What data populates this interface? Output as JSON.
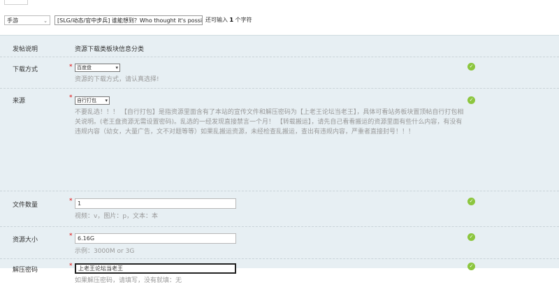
{
  "title_row": {
    "type_select": "手游",
    "title_value": "[SLG/动态/官中步兵] 谁能想到？Who thought it's possil",
    "remain_prefix": "还可输入",
    "remain_count": "1",
    "remain_suffix": "个字符"
  },
  "form": {
    "header_label": "发帖说明",
    "header_title": "资源下载类板块信息分类",
    "download_method": {
      "label": "下载方式",
      "select_value": "百度盘",
      "hint": "资源的下载方式，请认真选择!"
    },
    "source": {
      "label": "来源",
      "select_value": "自行打包",
      "description": "不要乱选！！！ 【自行打包】是指资源里面含有了本站的宣传文件和解压密码为【上老王论坛当老王】，具体可看站务板块置顶帖自行打包相关说明。(老王盘资源无需设置密码)。乱选的一经发现直接禁言一个月！ 【转载搬运】，请先自己看看搬运的资源里面有些什么内容，有没有违规内容（幼女，大量广告，文不对题等等）如果乱搬运资源，未经检查乱搬运，查出有违规内容，严重者直接封号！！！"
    },
    "file_count": {
      "label": "文件数量",
      "value": "1",
      "hint": "视频：v，图片：p，文本：本"
    },
    "resource_size": {
      "label": "资源大小",
      "value": "6.16G",
      "hint": "示例：3000M or 3G"
    },
    "unzip_password": {
      "label": "解压密码",
      "value": "上老王论坛当老王",
      "hint": "如果解压密码，请填写，没有就填：无"
    },
    "required_mark": "*",
    "ok_icon": "check-circle-icon",
    "ok_color": "#8cc63e"
  }
}
